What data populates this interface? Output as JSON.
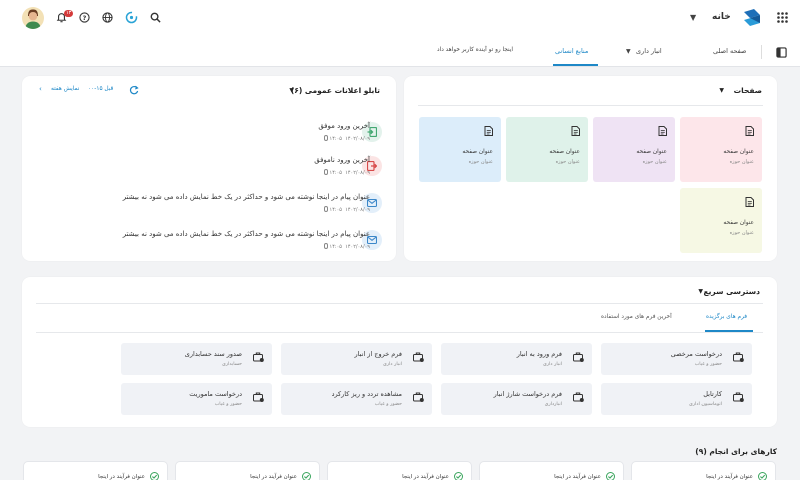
{
  "header": {
    "brand_name": "خانه",
    "notification_count": "۱۳",
    "icons": [
      "apps-icon",
      "search-icon",
      "sync-icon",
      "globe-icon",
      "help-icon",
      "bell-icon"
    ]
  },
  "nav": {
    "items": [
      {
        "label": "صفحه اصلی",
        "active": false
      },
      {
        "label": "انبار داری",
        "active": false
      },
      {
        "label": "منابع انسانی",
        "active": true
      },
      {
        "label": "اینجا رو تو آینده کاربر خواهد داد",
        "active": false
      }
    ]
  },
  "pages": {
    "title": "صفحات",
    "tiles": [
      {
        "title": "عنوان صفحه",
        "subtitle": "عنوان حوزه",
        "color": "#fde6ea"
      },
      {
        "title": "عنوان صفحه",
        "subtitle": "عنوان حوزه",
        "color": "#efe3f4"
      },
      {
        "title": "عنوان صفحه",
        "subtitle": "عنوان حوزه",
        "color": "#dff2ea"
      },
      {
        "title": "عنوان صفحه",
        "subtitle": "عنوان حوزه",
        "color": "#dcedfa"
      },
      {
        "title": "عنوان صفحه",
        "subtitle": "عنوان حوزه",
        "color": "#f6f8e4"
      }
    ]
  },
  "board": {
    "title": "تابلو اعلانات عمومی (۶)",
    "show_week": "نمایش هفته",
    "prev": "قبل ۱۵-۰۰",
    "items": [
      {
        "text": "آخرین ورود موفق",
        "date": "۱۴۰۲/۰۸/۰۹",
        "time": "۱۴:۰۵",
        "kind": "login-success",
        "color": "#e3f2ec",
        "icolor": "#43a872"
      },
      {
        "text": "آخرین ورود ناموفق",
        "date": "۱۴۰۲/۰۸/۰۹",
        "time": "۱۴:۰۵",
        "kind": "login-failed",
        "color": "#fbe4e4",
        "icolor": "#d84a4a"
      },
      {
        "text": "عنوان پیام در اینجا نوشته می شود و حداکثر در یک خط نمایش داده می شود نه بیشتر",
        "date": "۱۴۰۲/۰۸/۰۹",
        "time": "۱۴:۰۵",
        "kind": "message",
        "color": "#e3effa",
        "icolor": "#3b87c9"
      },
      {
        "text": "عنوان پیام در اینجا نوشته می شود و حداکثر در یک خط نمایش داده می شود نه بیشتر",
        "date": "۱۴۰۲/۰۸/۰۹",
        "time": "۱۴:۰۵",
        "kind": "message",
        "color": "#e3effa",
        "icolor": "#3b87c9"
      }
    ]
  },
  "quick": {
    "title": "دسترسی سریع",
    "tabs": [
      {
        "label": "فرم های برگزیده",
        "active": true
      },
      {
        "label": "آخرین فرم های مورد استفاده",
        "active": false
      }
    ],
    "forms": [
      {
        "title": "درخواست مرخصی",
        "subtitle": "حضور و غیاب"
      },
      {
        "title": "فرم ورود به انبار",
        "subtitle": "انبار داری"
      },
      {
        "title": "فرم خروج از انبار",
        "subtitle": "انبار داری"
      },
      {
        "title": "صدور سند حسابداری",
        "subtitle": "حسابداری"
      },
      {
        "title": "کارتابل",
        "subtitle": "اتوماسیون اداری"
      },
      {
        "title": "فرم درخواست شارژ انبار",
        "subtitle": "انبارداری"
      },
      {
        "title": "مشاهده تردد و ریز کارکرد",
        "subtitle": "حضور و غیاب"
      },
      {
        "title": "درخواست ماموریت",
        "subtitle": "حضور و غیاب"
      }
    ]
  },
  "todo": {
    "title": "کارهای برای انجام (۹)",
    "items": [
      "عنوان فرآیند در اینجا",
      "عنوان فرآیند در اینجا",
      "عنوان فرآیند در اینجا",
      "عنوان فرآیند در اینجا",
      "عنوان فرآیند در اینجا"
    ]
  }
}
